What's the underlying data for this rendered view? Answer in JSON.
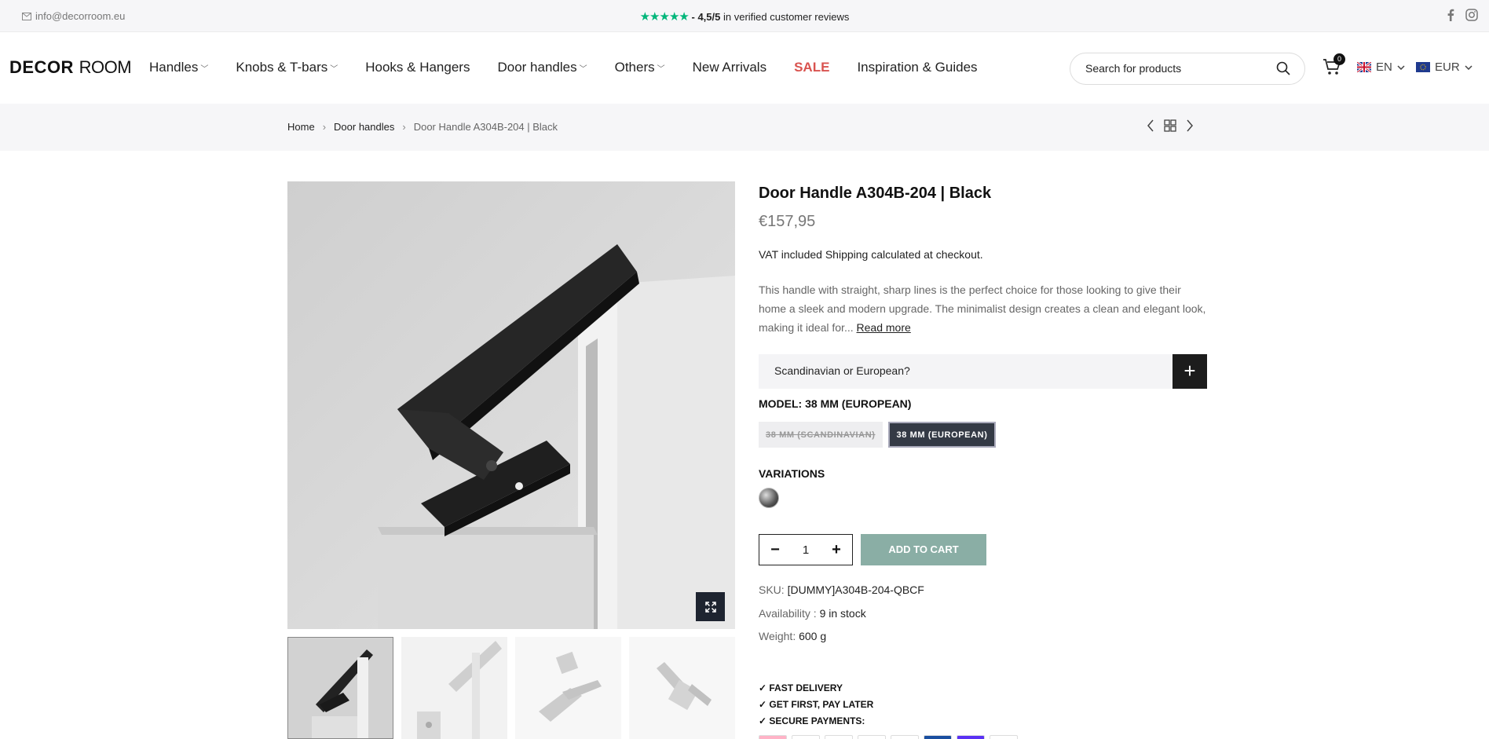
{
  "topbar": {
    "email": "info@decorroom.eu",
    "rating": "4,5/5",
    "rating_suffix": "in verified customer reviews"
  },
  "header": {
    "logo_bold": "DECOR",
    "logo_light": "ROOM",
    "nav": [
      {
        "label": "Handles",
        "has_dropdown": true
      },
      {
        "label": "Knobs & T-bars",
        "has_dropdown": true
      },
      {
        "label": "Hooks & Hangers",
        "has_dropdown": false
      },
      {
        "label": "Door handles",
        "has_dropdown": true
      },
      {
        "label": "Others",
        "has_dropdown": true
      },
      {
        "label": "New Arrivals",
        "has_dropdown": false
      },
      {
        "label": "SALE",
        "has_dropdown": false
      },
      {
        "label": "Inspiration & Guides",
        "has_dropdown": false
      }
    ],
    "search_placeholder": "Search for products",
    "cart_count": "0",
    "language": "EN",
    "currency": "EUR"
  },
  "breadcrumb": {
    "home": "Home",
    "category": "Door handles",
    "current": "Door Handle A304B-204 | Black"
  },
  "product": {
    "title": "Door Handle A304B-204 | Black",
    "price": "€157,95",
    "vat_prefix": "VAT included",
    "shipping_link": "Shipping",
    "vat_suffix": "calculated at checkout.",
    "description": "This handle with straight, sharp lines is the perfect choice for those looking to give their home a sleek and modern upgrade. The minimalist design creates a clean and elegant look, making it ideal for...",
    "read_more": "Read more",
    "accordion_label": "Scandinavian or European?",
    "model_label": "MODEL: 38 MM (EUROPEAN)",
    "model_options": [
      "38 MM (SCANDINAVIAN)",
      "38 MM (EUROPEAN)"
    ],
    "variations_label": "VARIATIONS",
    "quantity": "1",
    "add_to_cart": "ADD TO CART",
    "sku_label": "SKU:",
    "sku": "[DUMMY]A304B-204-QBCF",
    "availability_label": "Availability :",
    "availability": "9 in stock",
    "weight_label": "Weight:",
    "weight": "600 g",
    "perks": [
      "✓ FAST DELIVERY",
      "✓ GET FIRST, PAY LATER",
      "✓ SECURE PAYMENTS:"
    ]
  },
  "colors": {
    "trustpilot_green": "#00b67a",
    "sale_red": "#d9534f",
    "add_to_cart_bg": "#8aaea5",
    "selected_option_bg": "#343a45"
  }
}
